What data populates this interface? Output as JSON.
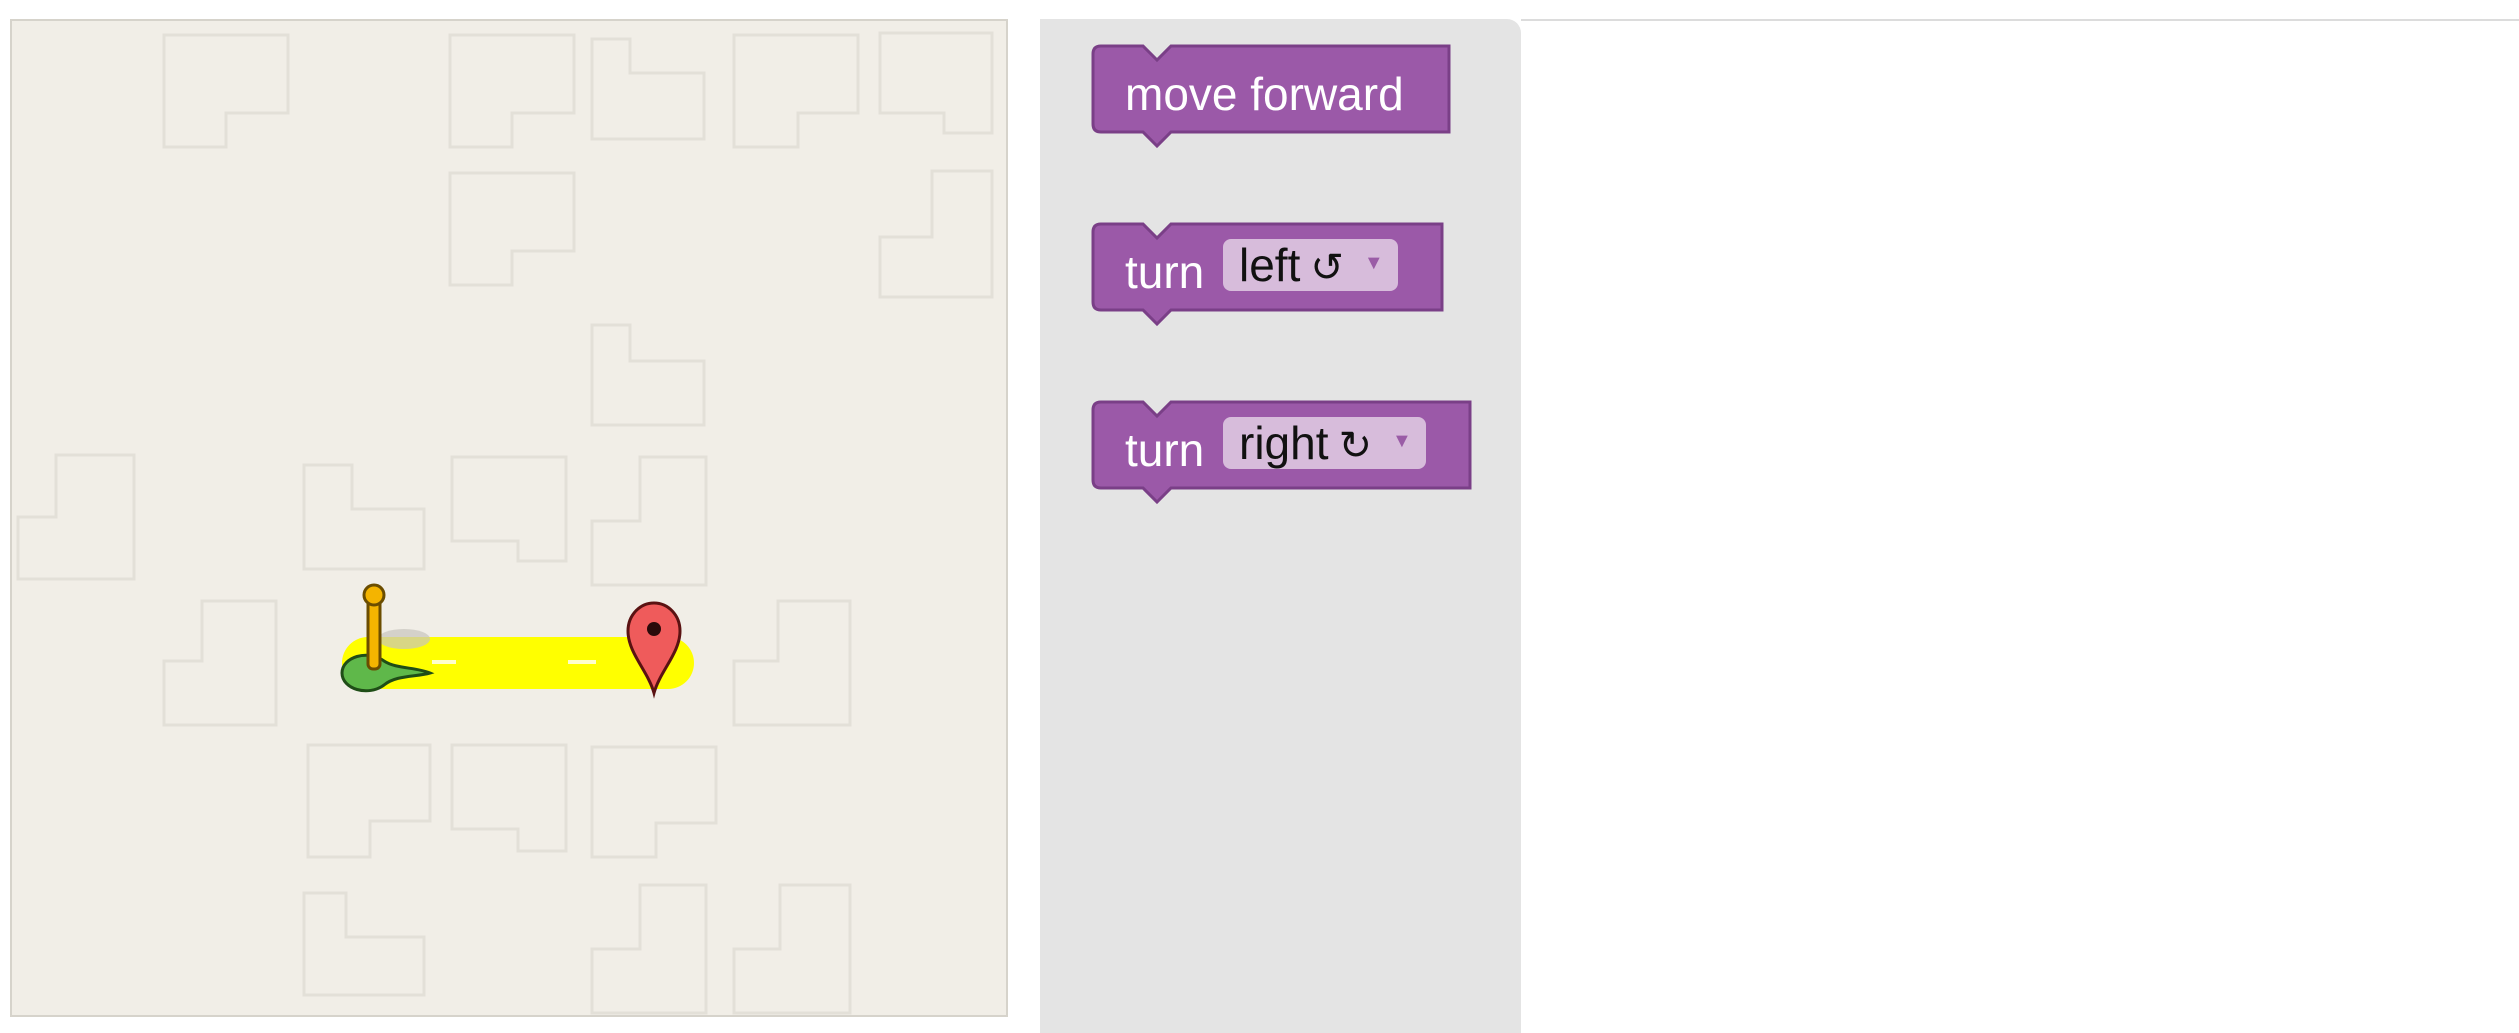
{
  "toolbox": {
    "blocks": [
      {
        "label": "move forward"
      },
      {
        "label": "turn",
        "dropdown": {
          "value": "left",
          "symbol": "↺"
        }
      },
      {
        "label": "turn",
        "dropdown": {
          "value": "right",
          "symbol": "↻"
        }
      }
    ]
  },
  "colors": {
    "block": "#9b59a8",
    "block_border": "#7a3f87",
    "dropdown_bg": "#d7bcdb",
    "path": "#ffff00",
    "maze_bg": "#f1eee7",
    "toolbox_bg": "#e4e4e4"
  },
  "maze": {
    "start_marker": "pegman-icon",
    "goal_marker": "map-pin-icon"
  }
}
